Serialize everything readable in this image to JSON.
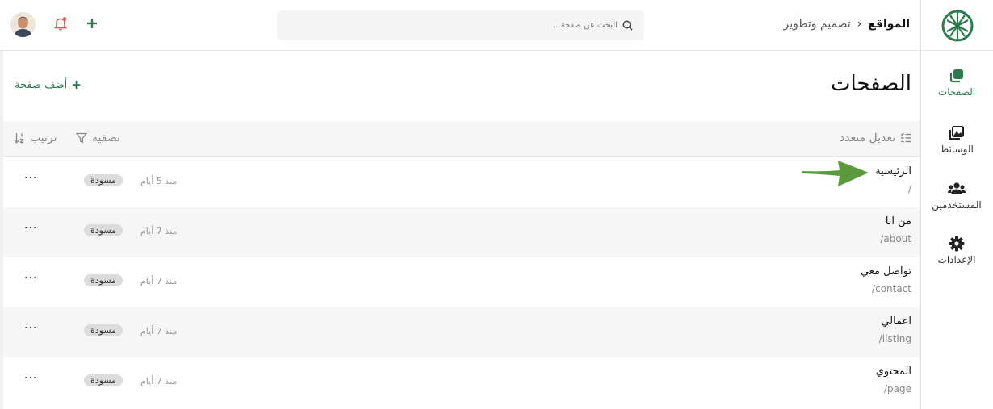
{
  "topbar": {
    "breadcrumb": {
      "root": "المواقع",
      "separator": "›",
      "current": "تصميم وتطوير"
    },
    "search": {
      "placeholder": "البحث عن صفحة..."
    }
  },
  "sidebar": {
    "items": [
      {
        "label": "الصفحات",
        "icon": "pages-icon",
        "active": true
      },
      {
        "label": "الوسائط",
        "icon": "media-icon"
      },
      {
        "label": "المستخدمين",
        "icon": "users-icon"
      },
      {
        "label": "الإعدادات",
        "icon": "gear-icon"
      }
    ]
  },
  "main": {
    "title": "الصفحات",
    "add_page_label": "أضف صفحة",
    "toolbar": {
      "bulk_edit_label": "تعديل متعدد",
      "filter_label": "تصفية",
      "sort_label": "ترتيب"
    },
    "pages": [
      {
        "title": "الرئيسية",
        "path": "/",
        "time": "منذ 5 أيام",
        "status": "مسودة"
      },
      {
        "title": "من انا",
        "path": "/about",
        "time": "منذ 7 أيام",
        "status": "مسودة"
      },
      {
        "title": "تواصل معي",
        "path": "/contact",
        "time": "منذ 7 أيام",
        "status": "مسودة"
      },
      {
        "title": "اعمالي",
        "path": "/listing",
        "time": "منذ 7 أيام",
        "status": "مسودة"
      },
      {
        "title": "المحتوي",
        "path": "/page",
        "time": "منذ 7 أيام",
        "status": "مسودة"
      }
    ],
    "more_label": "···"
  },
  "colors": {
    "accent": "#2d7a4f",
    "notification": "#e5534b",
    "arrow": "#5a9a3c"
  }
}
